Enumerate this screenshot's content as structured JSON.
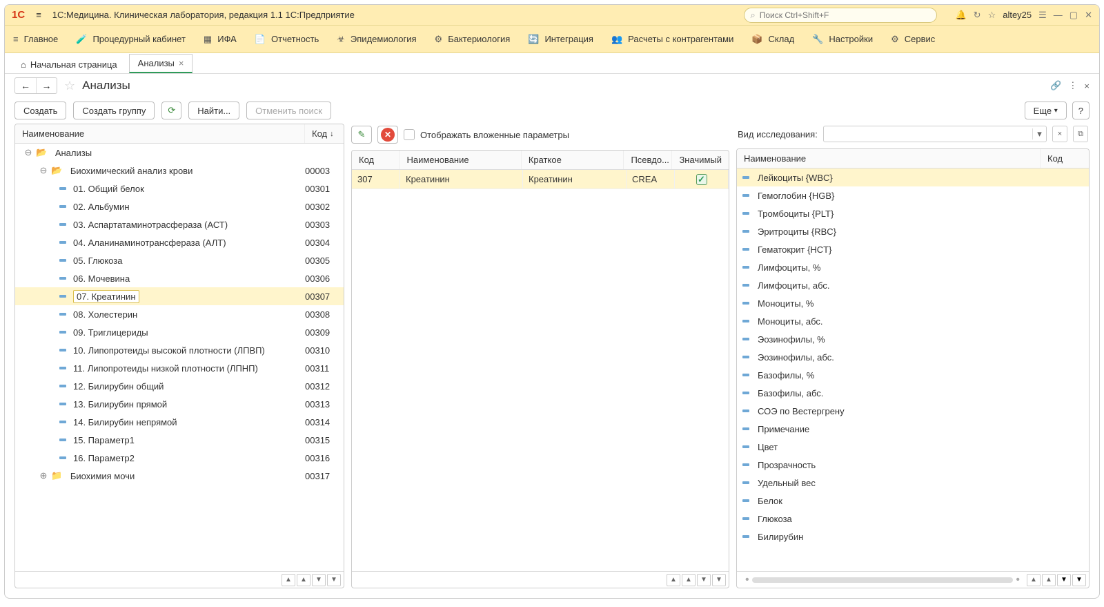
{
  "app": {
    "title": "1С:Медицина. Клиническая лаборатория, редакция 1.1 1С:Предприятие",
    "search_placeholder": "Поиск Ctrl+Shift+F",
    "user": "altey25"
  },
  "menu": [
    {
      "icon": "menu",
      "label": "Главное"
    },
    {
      "icon": "vial",
      "label": "Процедурный кабинет"
    },
    {
      "icon": "grid",
      "label": "ИФА"
    },
    {
      "icon": "doc",
      "label": "Отчетность"
    },
    {
      "icon": "virus",
      "label": "Эпидемиология"
    },
    {
      "icon": "virus2",
      "label": "Бактериология"
    },
    {
      "icon": "sync",
      "label": "Интеграция"
    },
    {
      "icon": "people",
      "label": "Расчеты с контрагентами"
    },
    {
      "icon": "box",
      "label": "Склад"
    },
    {
      "icon": "wrench",
      "label": "Настройки"
    },
    {
      "icon": "gear",
      "label": "Сервис"
    }
  ],
  "tabs": {
    "home": "Начальная страница",
    "active": "Анализы"
  },
  "page": {
    "title": "Анализы",
    "btn_create": "Создать",
    "btn_create_group": "Создать группу",
    "btn_find": "Найти...",
    "btn_cancel_search": "Отменить поиск",
    "btn_more": "Еще"
  },
  "left": {
    "col_name": "Наименование",
    "col_code": "Код",
    "root": "Анализы",
    "group1": {
      "name": "Биохимический анализ крови",
      "code": "00003"
    },
    "items": [
      {
        "name": "01. Общий белок",
        "code": "00301"
      },
      {
        "name": "02. Альбумин",
        "code": "00302"
      },
      {
        "name": "03. Аспартатаминотрасфераза (АСТ)",
        "code": "00303"
      },
      {
        "name": "04. Аланинаминотрансфераза (АЛТ)",
        "code": "00304"
      },
      {
        "name": "05. Глюкоза",
        "code": "00305"
      },
      {
        "name": "06. Мочевина",
        "code": "00306"
      },
      {
        "name": "07. Креатинин",
        "code": "00307",
        "selected": true
      },
      {
        "name": "08. Холестерин",
        "code": "00308"
      },
      {
        "name": "09. Триглицериды",
        "code": "00309"
      },
      {
        "name": "10. Липопротеиды высокой плотности (ЛПВП)",
        "code": "00310"
      },
      {
        "name": "11. Липопротеиды низкой плотности (ЛПНП)",
        "code": "00311"
      },
      {
        "name": "12. Билирубин общий",
        "code": "00312"
      },
      {
        "name": "13. Билирубин прямой",
        "code": "00313"
      },
      {
        "name": "14. Билирубин непрямой",
        "code": "00314"
      },
      {
        "name": "15. Параметр1",
        "code": "00315"
      },
      {
        "name": "16. Параметр2",
        "code": "00316"
      }
    ],
    "group2": {
      "name": "Биохимия мочи",
      "code": "00317"
    }
  },
  "mid": {
    "chk_label": "Отображать вложенные параметры",
    "col_code": "Код",
    "col_name": "Наименование",
    "col_short": "Краткое",
    "col_pseudo": "Псевдо...",
    "col_sig": "Значимый",
    "row": {
      "code": "307",
      "name": "Креатинин",
      "short": "Креатинин",
      "pseudo": "CREA"
    }
  },
  "right": {
    "filter_label": "Вид исследования:",
    "col_name": "Наименование",
    "col_code": "Код",
    "items": [
      "Лейкоциты {WBC}",
      "Гемоглобин {HGB}",
      "Тромбоциты {PLT}",
      "Эритроциты {RBC}",
      "Гематокрит {HCT}",
      "Лимфоциты, %",
      "Лимфоциты, абс.",
      "Моноциты, %",
      "Моноциты, абс.",
      "Эозинофилы, %",
      "Эозинофилы, абс.",
      "Базофилы, %",
      "Базофилы, абс.",
      "СОЭ по Вестергрену",
      "Примечание",
      "Цвет",
      "Прозрачность",
      "Удельный вес",
      "Белок",
      "Глюкоза",
      "Билирубин"
    ]
  }
}
